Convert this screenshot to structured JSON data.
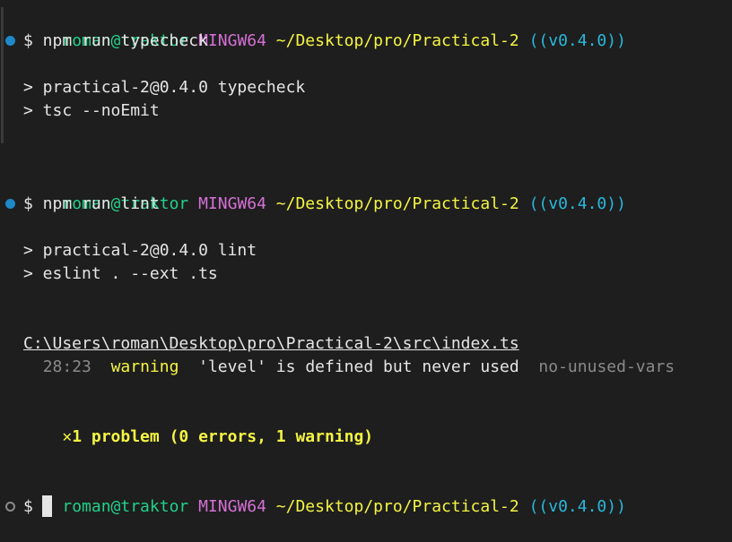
{
  "prompt": {
    "user": "roman@traktor",
    "system": "MINGW64",
    "path": "~/Desktop/pro/Practical-2",
    "branch": "((v0.4.0))"
  },
  "blocks": [
    {
      "command": "$ npm run typecheck",
      "output": [
        "> practical-2@0.4.0 typecheck",
        "> tsc --noEmit"
      ],
      "status": "success"
    },
    {
      "command": "$ npm run lint",
      "output": [
        "> practical-2@0.4.0 lint",
        "> eslint . --ext .ts"
      ],
      "status": "success"
    }
  ],
  "lint": {
    "file": "C:\\Users\\roman\\Desktop\\pro\\Practical-2\\src\\index.ts",
    "location": "28:23",
    "severity": "warning",
    "message": "'level' is defined but never used",
    "rule": "no-unused-vars",
    "summary_icon": "✕",
    "summary": "1 problem (0 errors, 1 warning)"
  },
  "current": {
    "dollar": "$",
    "status": "idle"
  },
  "colors": {
    "background": "#1e1e1e",
    "user": "#23d18b",
    "system": "#d670d6",
    "path": "#f5f543",
    "branch": "#29b8db",
    "decoration_success": "#1e88c8"
  }
}
